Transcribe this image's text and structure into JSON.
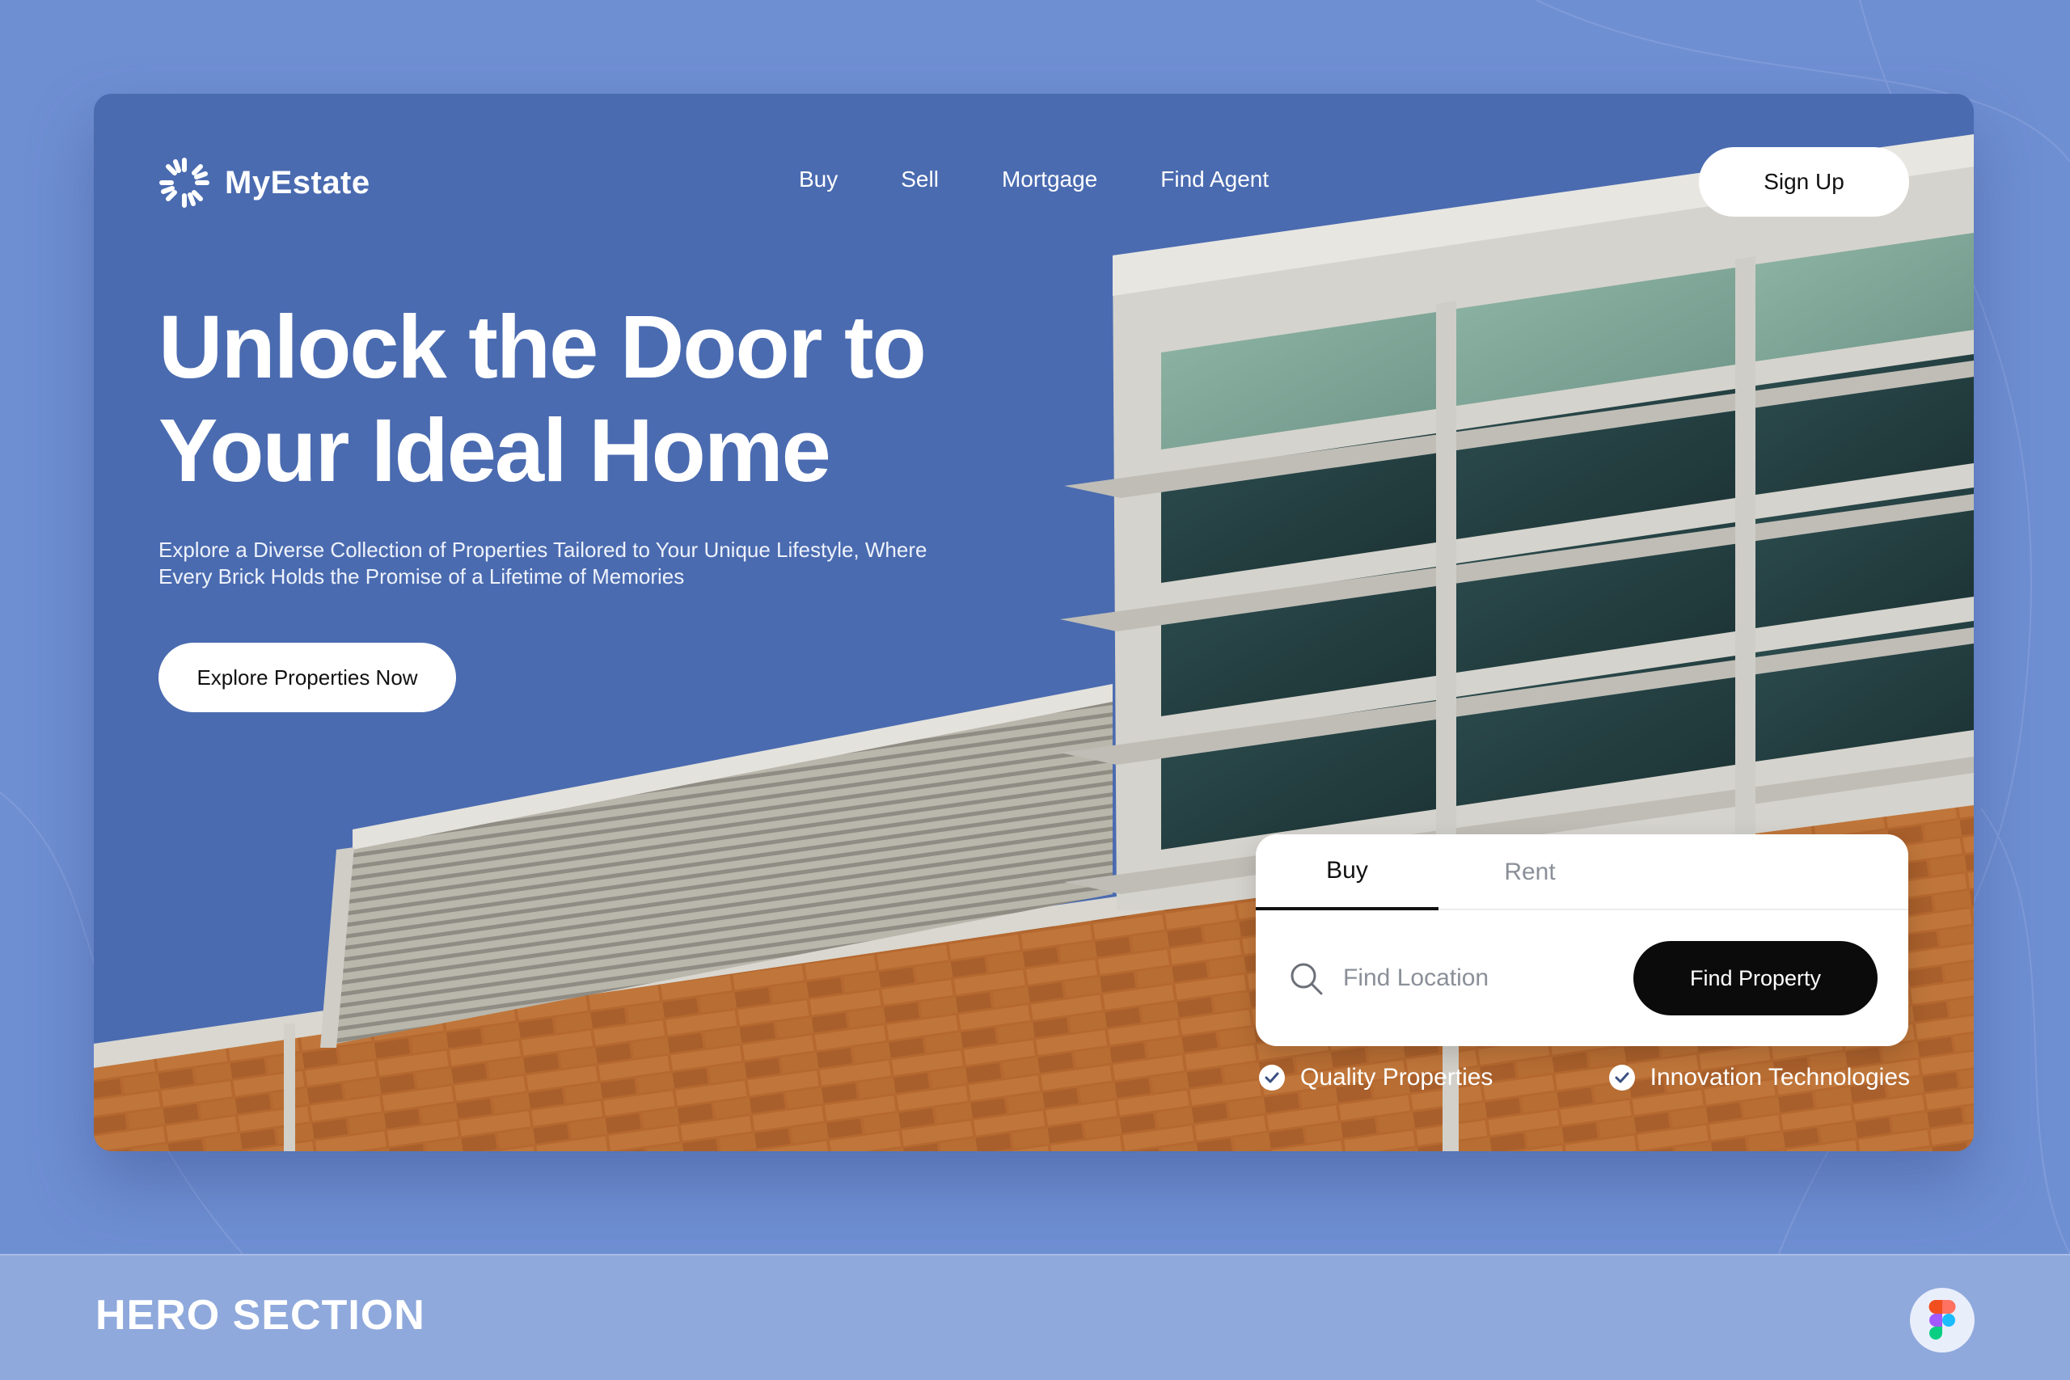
{
  "brand": {
    "name": "MyEstate",
    "logo_icon": "sunburst-icon"
  },
  "nav": {
    "items": [
      {
        "label": "Buy"
      },
      {
        "label": "Sell"
      },
      {
        "label": "Mortgage"
      },
      {
        "label": "Find Agent"
      }
    ],
    "signup_label": "Sign Up"
  },
  "hero": {
    "headline_line1": "Unlock the Door to",
    "headline_line2": "Your Ideal Home",
    "subtext_line1": "Explore a Diverse Collection of Properties Tailored to Your Unique Lifestyle, Where",
    "subtext_line2": "Every Brick Holds the Promise of a Lifetime of Memories",
    "cta_label": "Explore Properties Now"
  },
  "search": {
    "tabs": [
      {
        "label": "Buy",
        "active": true
      },
      {
        "label": "Rent",
        "active": false
      }
    ],
    "placeholder": "Find Location",
    "value": "",
    "button_label": "Find Property",
    "icon": "search-icon"
  },
  "features": [
    {
      "label": "Quality Properties",
      "icon": "check-circle-icon"
    },
    {
      "label": "Innovation Technologies",
      "icon": "check-circle-icon"
    }
  ],
  "footer": {
    "title": "HERO SECTION",
    "badge_icon": "figma-icon"
  },
  "colors": {
    "page_bg": "#6f8fd3",
    "hero_sky": "#4a6bb0",
    "footer_bg": "#8fa9dc",
    "button_dark": "#0b0b0c",
    "brick": "#b66a35"
  }
}
